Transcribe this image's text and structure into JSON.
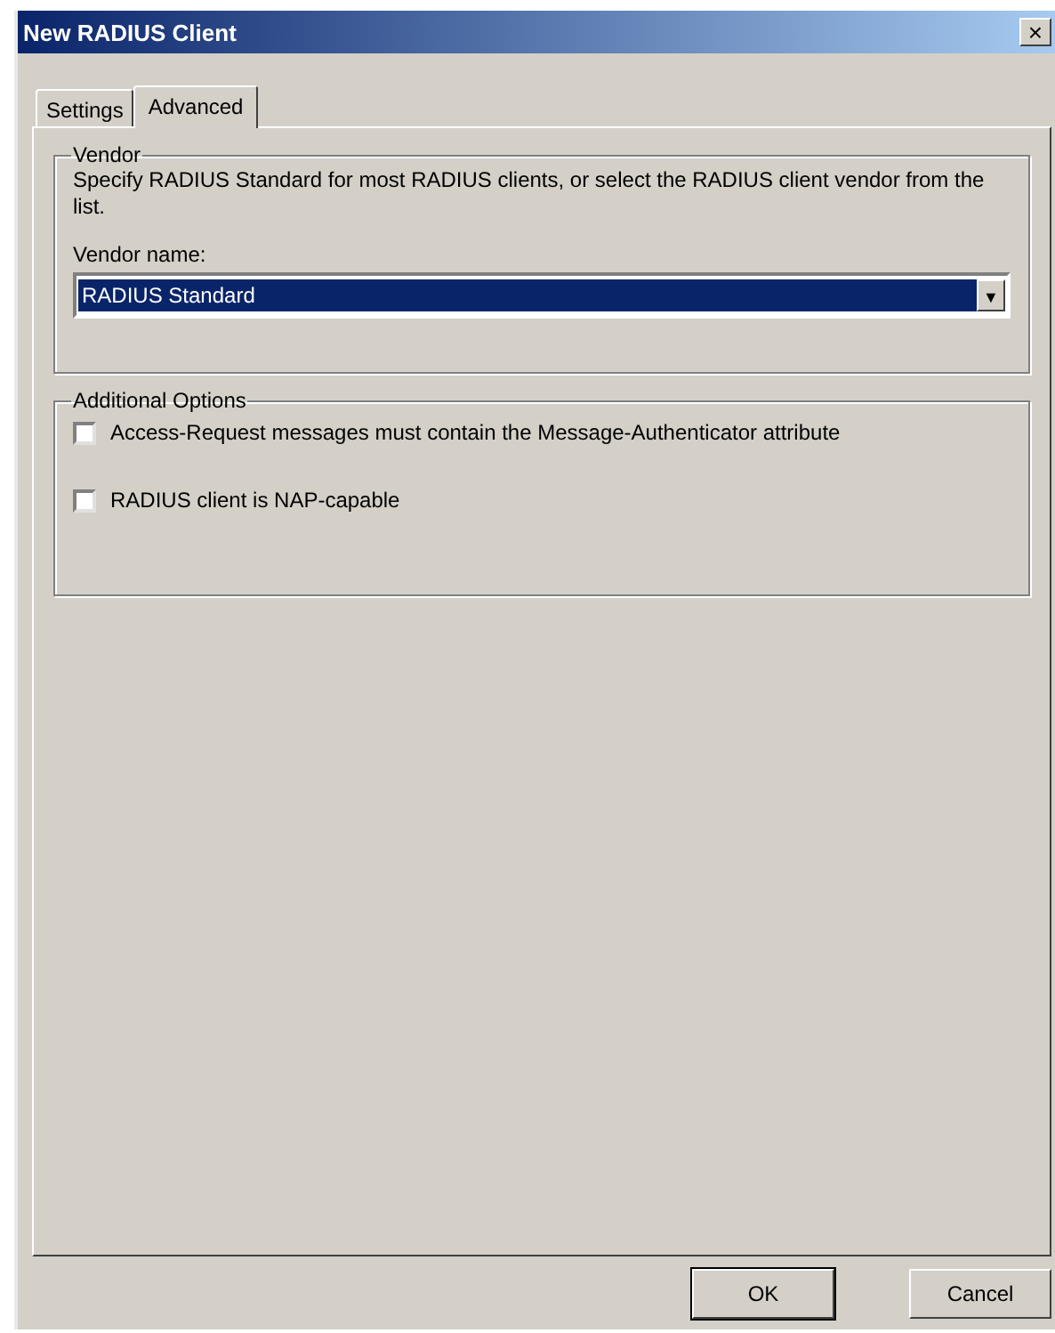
{
  "window": {
    "title": "New RADIUS Client",
    "close": "×"
  },
  "tabs": [
    {
      "label": "Settings",
      "selected": false
    },
    {
      "label": "Advanced",
      "selected": true
    }
  ],
  "vendor_group": {
    "title": "Vendor",
    "description": "Specify RADIUS Standard for most RADIUS clients, or select the RADIUS client vendor from the list.",
    "field_label": "Vendor name:",
    "dropdown": {
      "value": "RADIUS Standard",
      "arrow": "▼"
    }
  },
  "options_group": {
    "title": "Additional Options",
    "options": [
      {
        "label": "Access-Request messages must contain the Message-Authenticator attribute",
        "checked": false
      },
      {
        "label": "RADIUS client is NAP-capable",
        "checked": false
      }
    ]
  },
  "buttons": [
    {
      "label": "OK",
      "default": true
    },
    {
      "label": "Cancel",
      "default": false
    }
  ]
}
